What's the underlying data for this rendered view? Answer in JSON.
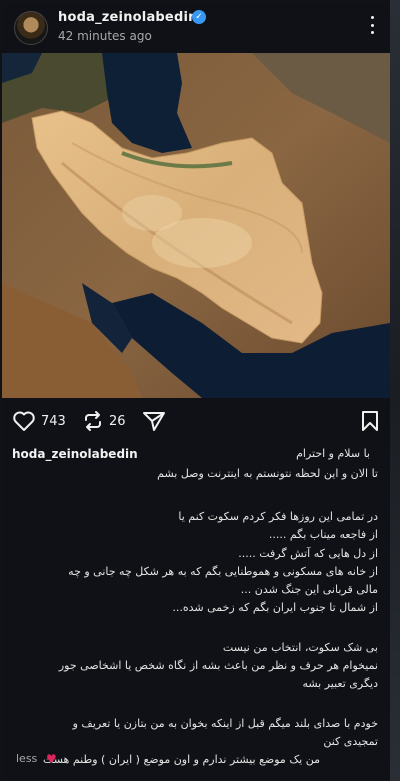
{
  "post": {
    "username": "hoda_zeinolabedin",
    "time_ago": "42 minutes ago",
    "likes": "743",
    "reposts": "26"
  },
  "caption": {
    "username": "hoda_zeinolabedin",
    "greeting": "با سلام و احترام",
    "lines": [
      "تا الان و این لحظه نتونستم به اینترنت وصل بشم",
      "",
      "در تمامی این روزها فکر کردم سکوت کنم یا",
      "از فاجعه میناب بگم .....",
      "از دل هایی که آتش گرفت .....",
      "از خانه های مسکونی و هموطنایی بگم که به هر شکل چه جانی و چه",
      "مالی قربانی این جنگ شدن ...",
      "از شمال تا جنوب ایران بگم که زخمی شده...",
      "",
      "بی شک سکوت، انتخاب من نیست",
      "نمیخوام هر حرف و نظر من باعث بشه از نگاه شخص یا اشخاصی جور",
      "دیگری تعبیر بشه",
      "",
      "خودم با صدای بلند میگم قبل از اینکه بخوان به من بتازن یا تعریف و",
      "تمجیدی کنن",
      "من یک موضع بیشتر ندارم و اون موضع ( ایران ) وطنم هست",
      "less"
    ]
  },
  "icons": {
    "like": "heart-icon",
    "repost": "repost-icon",
    "share": "share-icon",
    "save": "bookmark-icon",
    "more": "more-options-icon",
    "verified": "verified-badge-icon"
  },
  "colors": {
    "background": "#0f1116",
    "verified": "#3897f0",
    "text": "#e4e4e4"
  }
}
